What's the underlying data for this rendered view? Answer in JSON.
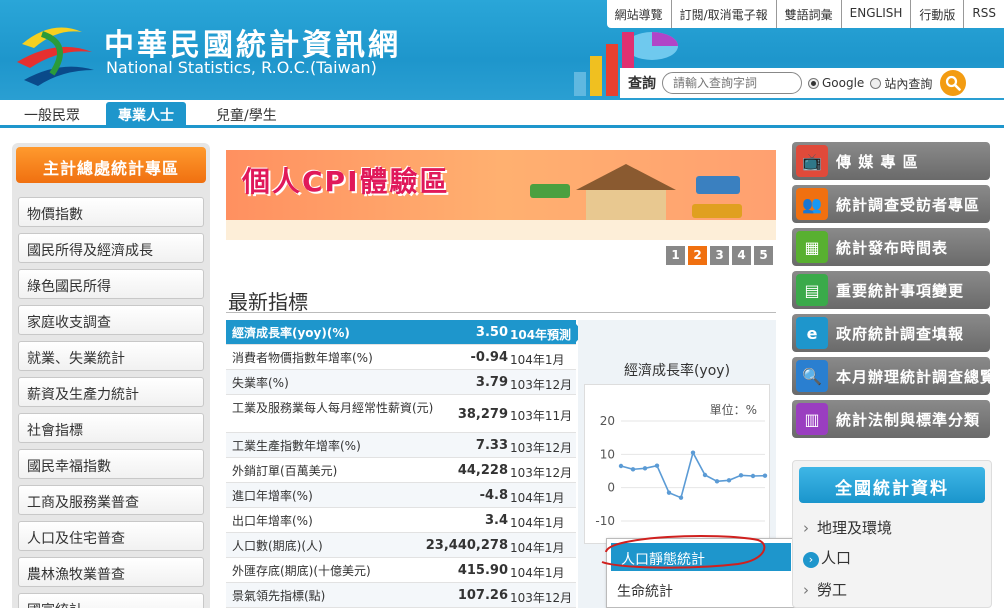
{
  "header": {
    "title_zh": "中華民國統計資訊網",
    "title_en": "National Statistics, R.O.C.(Taiwan)",
    "top_links": [
      "網站導覽",
      "訂閱/取消電子報",
      "雙語詞彙",
      "ENGLISH",
      "行動版",
      "RSS"
    ],
    "search": {
      "label": "查詢",
      "placeholder": "請輸入查詢字詞",
      "options": [
        "Google",
        "站內查詢"
      ],
      "selected": "Google"
    }
  },
  "audience_tabs": [
    "一般民眾",
    "專業人士",
    "兒童/學生"
  ],
  "audience_active": "專業人士",
  "left_sidebar": {
    "heading": "主計總處統計專區",
    "items": [
      "物價指數",
      "國民所得及經濟成長",
      "綠色國民所得",
      "家庭收支調查",
      "就業、失業統計",
      "薪資及生產力統計",
      "社會指標",
      "國民幸福指數",
      "工商及服務業普查",
      "人口及住宅普查",
      "農林漁牧業普查",
      "國富統計"
    ]
  },
  "banner": {
    "title": "個人CPI體驗區",
    "pages": [
      "1",
      "2",
      "3",
      "4",
      "5"
    ],
    "active_page": "2"
  },
  "indicators": {
    "title": "最新指標",
    "rows": [
      {
        "name": "經濟成長率(yoy)(%)",
        "value": "3.50",
        "date": "104年預測",
        "active": true
      },
      {
        "name": "消費者物價指數年增率(%)",
        "value": "-0.94",
        "date": "104年1月"
      },
      {
        "name": "失業率(%)",
        "value": "3.79",
        "date": "103年12月"
      },
      {
        "name": "工業及服務業每人每月經常性薪資(元)",
        "value": "38,279",
        "date": "103年11月",
        "tall": true
      },
      {
        "name": "工業生產指數年增率(%)",
        "value": "7.33",
        "date": "103年12月"
      },
      {
        "name": "外銷訂單(百萬美元)",
        "value": "44,228",
        "date": "103年12月"
      },
      {
        "name": "進口年增率(%)",
        "value": "-4.8",
        "date": "104年1月"
      },
      {
        "name": "出口年增率(%)",
        "value": "3.4",
        "date": "104年1月"
      },
      {
        "name": "人口數(期底)(人)",
        "value": "23,440,278",
        "date": "104年1月"
      },
      {
        "name": "外匯存底(期底)(十億美元)",
        "value": "415.90",
        "date": "104年1月"
      },
      {
        "name": "景氣領先指標(點)",
        "value": "107.26",
        "date": "103年12月"
      }
    ]
  },
  "chart_data": {
    "type": "line",
    "title": "經濟成長率(yoy)",
    "unit_label": "單位：%",
    "yticks": [
      "20",
      "10",
      "0",
      "-10"
    ],
    "ylim": [
      -10,
      20
    ],
    "x": [
      1,
      2,
      3,
      4,
      5,
      6,
      7,
      8,
      9,
      10,
      11,
      12,
      13
    ],
    "values": [
      6.5,
      5.5,
      5.8,
      6.6,
      -1.5,
      -3.0,
      10.5,
      3.8,
      1.9,
      2.2,
      3.7,
      3.5,
      3.6
    ],
    "color": "#5b9bd5"
  },
  "popup_menu": {
    "items": [
      "人口靜態統計",
      "生命統計"
    ],
    "active": "人口靜態統計"
  },
  "right_sidebar": {
    "buttons": [
      {
        "label": "傳 媒 專 區",
        "icon": "tv-icon",
        "color": "#e04a3a"
      },
      {
        "label": "統計調查受訪者專區",
        "icon": "people-icon",
        "color": "#f07010"
      },
      {
        "label": "統計發布時間表",
        "icon": "calendar-icon",
        "color": "#58b030"
      },
      {
        "label": "重要統計事項變更",
        "icon": "document-icon",
        "color": "#3aaa4a"
      },
      {
        "label": "政府統計調查填報",
        "icon": "e-icon",
        "color": "#1e96cc"
      },
      {
        "label": "本月辦理統計調查總覽",
        "icon": "search-doc-icon",
        "color": "#2a7fd0"
      },
      {
        "label": "統計法制與標準分類",
        "icon": "books-icon",
        "color": "#9a3ec0"
      }
    ],
    "nation_heading": "全國統計資料",
    "nation_items": [
      "地理及環境",
      "人口",
      "勞工"
    ],
    "nation_active": "人口"
  }
}
